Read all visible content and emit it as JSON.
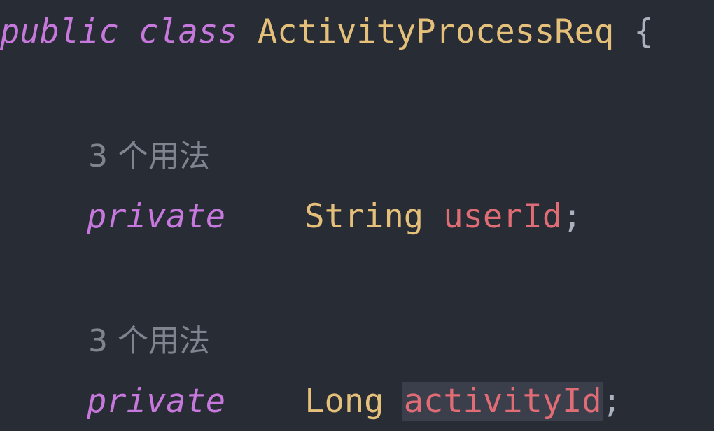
{
  "code": {
    "line1": {
      "kw1": "public",
      "kw2": "class",
      "class_name": "ActivityProcessReq",
      "brace": "{"
    },
    "hint1": "3 个用法",
    "line2": {
      "kw": "private",
      "type": "String",
      "field": "userId",
      "semi": ";"
    },
    "hint2": "3 个用法",
    "line3": {
      "kw": "private",
      "type": "Long",
      "field": "activityId",
      "semi": ";"
    }
  },
  "colors": {
    "background": "#282c34",
    "keyword": "#c678dd",
    "type": "#e5c07b",
    "field": "#e06c75",
    "punctuation": "#abb2bf",
    "inlay_hint": "#7f848e",
    "selection_highlight": "#3a3f4b"
  }
}
